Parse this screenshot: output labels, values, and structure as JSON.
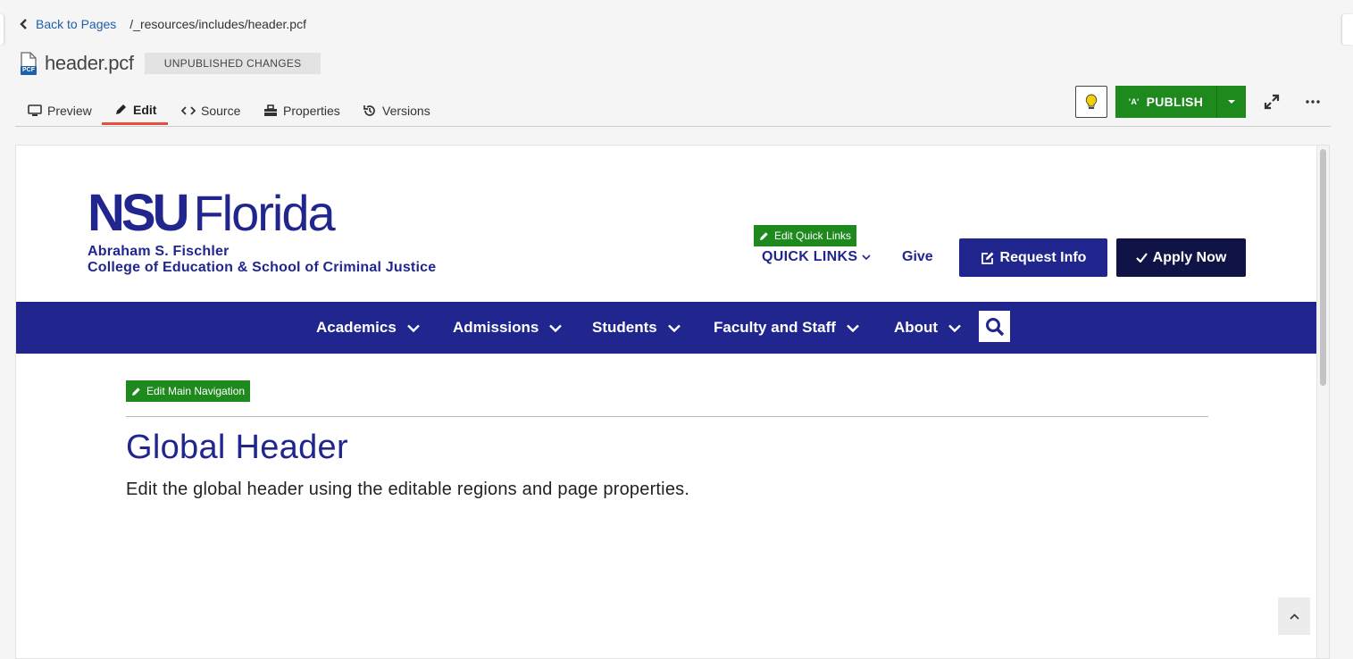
{
  "breadcrumb": {
    "back_label": "Back to Pages",
    "path": "/_resources/includes/header.pcf"
  },
  "file": {
    "name": "header.pcf",
    "icon_badge": "PCF",
    "status": "UNPUBLISHED CHANGES"
  },
  "tabs": [
    {
      "label": "Preview",
      "icon": "monitor-icon"
    },
    {
      "label": "Edit",
      "icon": "pencil-icon",
      "active": true
    },
    {
      "label": "Source",
      "icon": "code-icon"
    },
    {
      "label": "Properties",
      "icon": "toolbox-icon"
    },
    {
      "label": "Versions",
      "icon": "history-icon"
    }
  ],
  "toolbar": {
    "publish_label": "PUBLISH",
    "publish_glyph": "'A'"
  },
  "site": {
    "logo_nsu": "NSU",
    "logo_florida": "Florida",
    "logo_line1": "Abraham S. Fischler",
    "logo_line2": "College of Education & School of Criminal Justice",
    "edit_quick_links": "Edit Quick Links",
    "quick_links": "QUICK LINKS",
    "give": "Give",
    "request_info": "Request Info",
    "apply_now": "Apply Now",
    "nav": [
      "Academics",
      "Admissions",
      "Students",
      "Faculty and Staff",
      "About"
    ],
    "edit_main_nav": "Edit Main Navigation",
    "page_title": "Global Header",
    "page_desc": "Edit the global header using the editable regions and page properties."
  },
  "colors": {
    "brand_navy": "#21268f",
    "apply_dark": "#101345",
    "publish_green": "#1e8a1e",
    "active_tab": "#e84c3d",
    "link_blue": "#1f5fa8"
  }
}
